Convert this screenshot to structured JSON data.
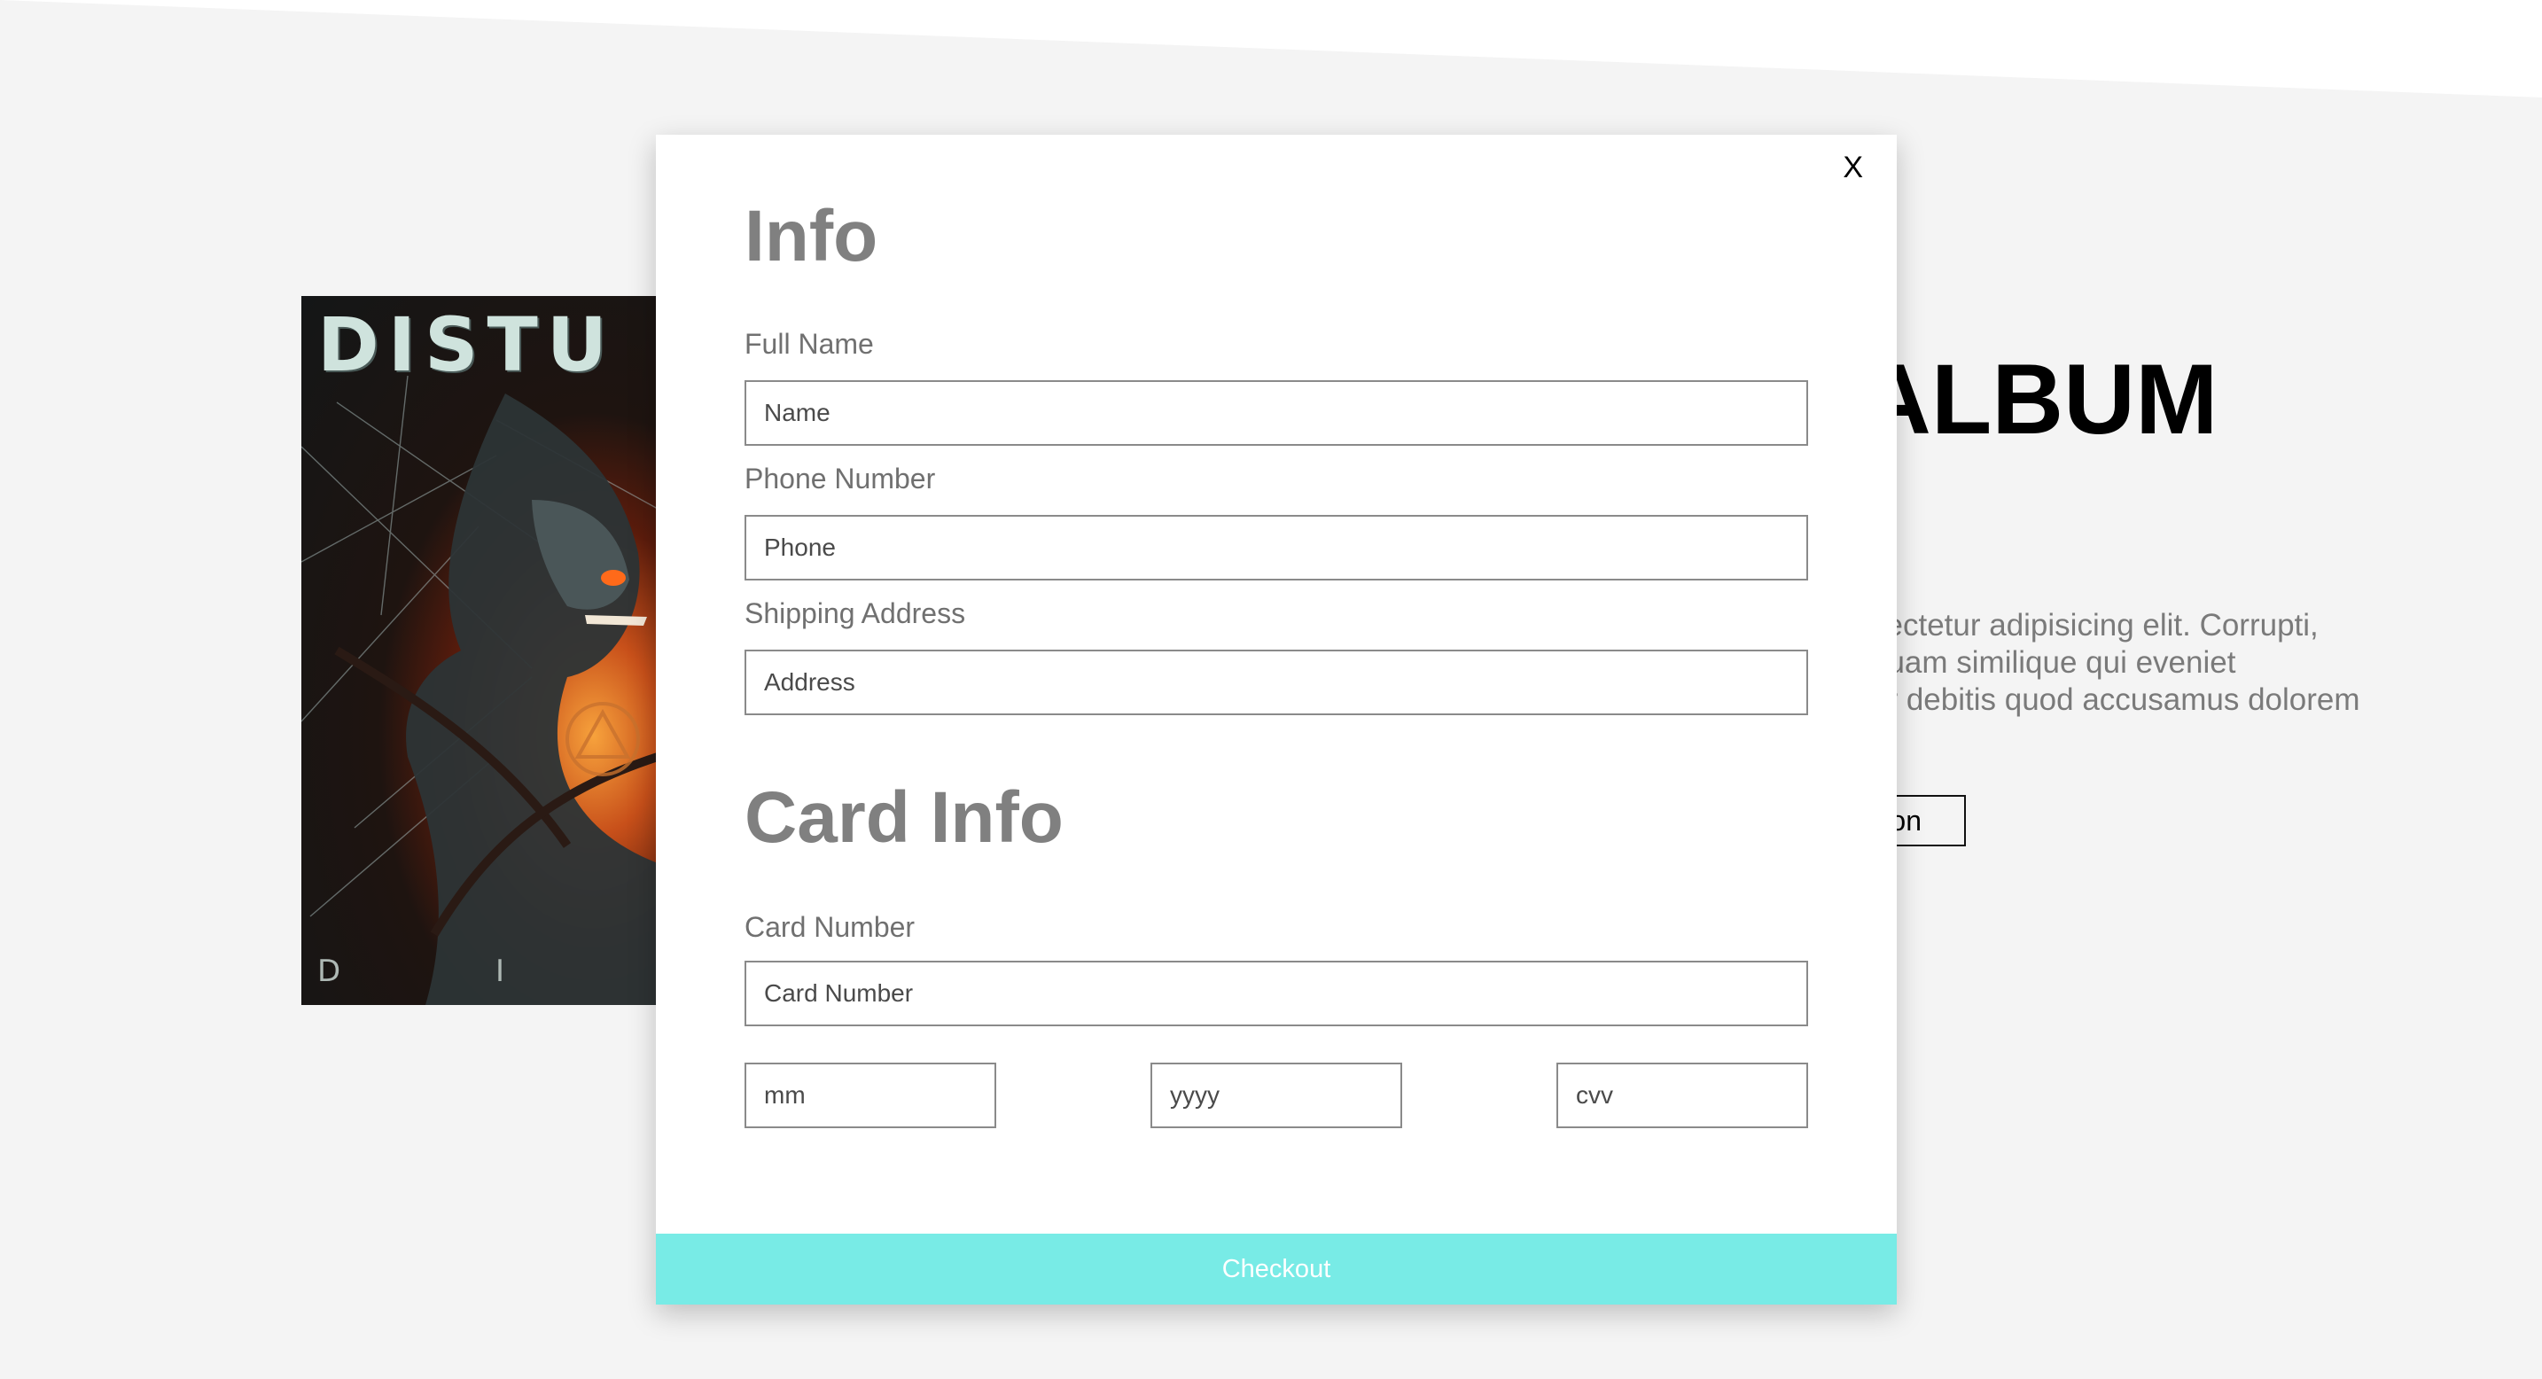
{
  "background": {
    "cover": {
      "title_text": "DISTU",
      "subtitle_text": "D I V I"
    },
    "album": {
      "title": "ALBUM",
      "description_lines": [
        "sectetur adipisicing elit. Corrupti,",
        "quam similique qui eveniet",
        "ur debitis quod accusamus dolorem"
      ],
      "button_label": "on"
    }
  },
  "modal": {
    "close_label": "X",
    "info_heading": "Info",
    "fields": {
      "full_name": {
        "label": "Full Name",
        "placeholder": "Name",
        "value": ""
      },
      "phone": {
        "label": "Phone Number",
        "placeholder": "Phone",
        "value": ""
      },
      "address": {
        "label": "Shipping Address",
        "placeholder": "Address",
        "value": ""
      }
    },
    "card_heading": "Card Info",
    "card": {
      "number": {
        "label": "Card Number",
        "placeholder": "Card Number",
        "value": ""
      },
      "month": {
        "placeholder": "mm",
        "value": ""
      },
      "year": {
        "placeholder": "yyyy",
        "value": ""
      },
      "cvv": {
        "placeholder": "cvv",
        "value": ""
      }
    },
    "checkout_label": "Checkout"
  },
  "colors": {
    "page_background": "#f4f4f4",
    "modal_background": "#ffffff",
    "heading_gray": "#808080",
    "checkout_accent": "#78ebe6",
    "checkout_text": "#ffffff"
  }
}
